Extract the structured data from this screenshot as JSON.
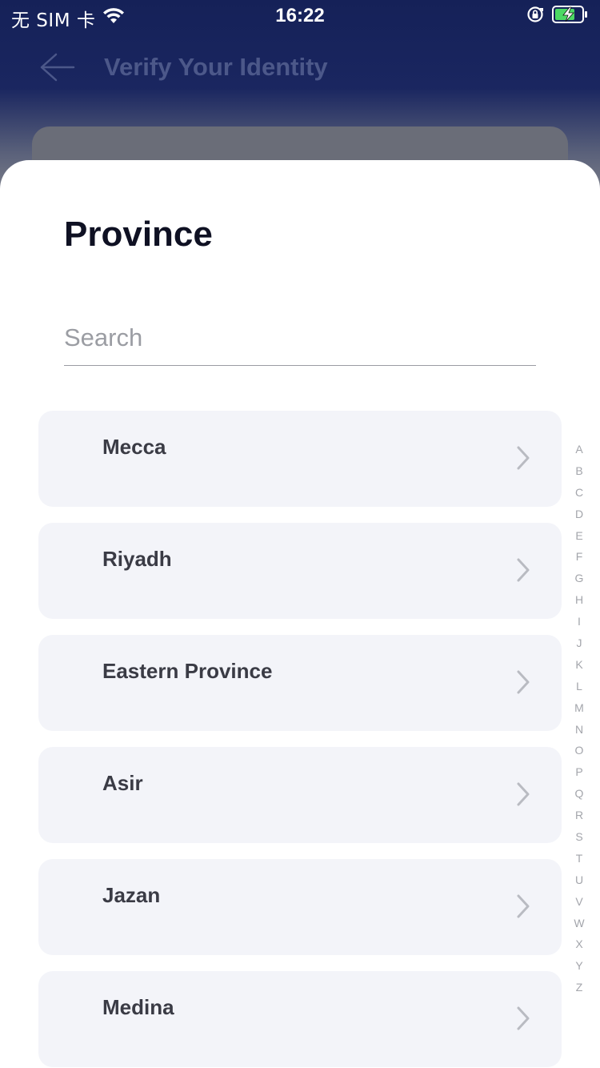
{
  "status_bar": {
    "carrier": "无 SIM 卡",
    "time": "16:22",
    "icons": [
      "wifi-icon",
      "rotation-lock-icon",
      "battery-charging-icon"
    ]
  },
  "background_page": {
    "title": "Verify Your Identity",
    "back_icon": "arrow-left-icon"
  },
  "sheet": {
    "title": "Province",
    "search_placeholder": "Search",
    "items": [
      {
        "label": "Mecca"
      },
      {
        "label": "Riyadh"
      },
      {
        "label": "Eastern Province"
      },
      {
        "label": "Asir"
      },
      {
        "label": "Jazan"
      },
      {
        "label": "Medina"
      }
    ],
    "index_letters": [
      "A",
      "B",
      "C",
      "D",
      "E",
      "F",
      "G",
      "H",
      "I",
      "J",
      "K",
      "L",
      "M",
      "N",
      "O",
      "P",
      "Q",
      "R",
      "S",
      "T",
      "U",
      "V",
      "W",
      "X",
      "Y",
      "Z"
    ]
  },
  "colors": {
    "header_bg": "#152158",
    "sheet_bg": "#ffffff",
    "item_bg": "#f3f4f9",
    "battery_green": "#4cd964"
  }
}
